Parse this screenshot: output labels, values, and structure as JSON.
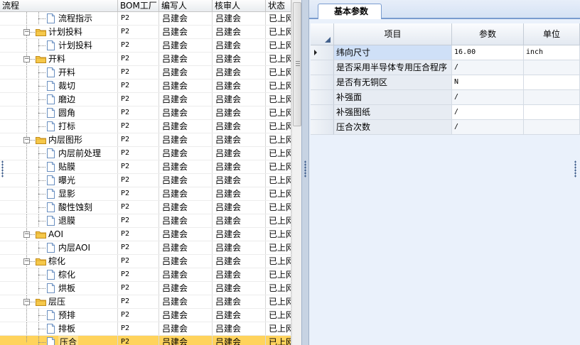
{
  "left_grid": {
    "columns": {
      "name": "流程",
      "bom": "BOM工厂",
      "writer": "编写人",
      "reviewer": "核审人",
      "status": "状态"
    },
    "rows": [
      {
        "type": "leaf",
        "name": "流程指示",
        "bom": "P2",
        "writer": "吕建会",
        "reviewer": "吕建会",
        "status": "已上网"
      },
      {
        "type": "folder",
        "name": "计划投料",
        "bom": "P2",
        "writer": "吕建会",
        "reviewer": "吕建会",
        "status": "已上网"
      },
      {
        "type": "leaf",
        "name": "计划投料",
        "bom": "P2",
        "writer": "吕建会",
        "reviewer": "吕建会",
        "status": "已上网"
      },
      {
        "type": "folder",
        "name": "开料",
        "bom": "P2",
        "writer": "吕建会",
        "reviewer": "吕建会",
        "status": "已上网"
      },
      {
        "type": "leaf",
        "name": "开料",
        "bom": "P2",
        "writer": "吕建会",
        "reviewer": "吕建会",
        "status": "已上网"
      },
      {
        "type": "leaf",
        "name": "裁切",
        "bom": "P2",
        "writer": "吕建会",
        "reviewer": "吕建会",
        "status": "已上网"
      },
      {
        "type": "leaf",
        "name": "磨边",
        "bom": "P2",
        "writer": "吕建会",
        "reviewer": "吕建会",
        "status": "已上网"
      },
      {
        "type": "leaf",
        "name": "圆角",
        "bom": "P2",
        "writer": "吕建会",
        "reviewer": "吕建会",
        "status": "已上网"
      },
      {
        "type": "leaf",
        "name": "打标",
        "bom": "P2",
        "writer": "吕建会",
        "reviewer": "吕建会",
        "status": "已上网"
      },
      {
        "type": "folder",
        "name": "内层图形",
        "bom": "P2",
        "writer": "吕建会",
        "reviewer": "吕建会",
        "status": "已上网"
      },
      {
        "type": "leaf",
        "name": "内层前处理",
        "bom": "P2",
        "writer": "吕建会",
        "reviewer": "吕建会",
        "status": "已上网"
      },
      {
        "type": "leaf",
        "name": "贴膜",
        "bom": "P2",
        "writer": "吕建会",
        "reviewer": "吕建会",
        "status": "已上网"
      },
      {
        "type": "leaf",
        "name": "曝光",
        "bom": "P2",
        "writer": "吕建会",
        "reviewer": "吕建会",
        "status": "已上网"
      },
      {
        "type": "leaf",
        "name": "显影",
        "bom": "P2",
        "writer": "吕建会",
        "reviewer": "吕建会",
        "status": "已上网"
      },
      {
        "type": "leaf",
        "name": "酸性蚀刻",
        "bom": "P2",
        "writer": "吕建会",
        "reviewer": "吕建会",
        "status": "已上网"
      },
      {
        "type": "leaf",
        "name": "退膜",
        "bom": "P2",
        "writer": "吕建会",
        "reviewer": "吕建会",
        "status": "已上网"
      },
      {
        "type": "folder",
        "name": "AOI",
        "bom": "P2",
        "writer": "吕建会",
        "reviewer": "吕建会",
        "status": "已上网"
      },
      {
        "type": "leaf",
        "name": "内层AOI",
        "bom": "P2",
        "writer": "吕建会",
        "reviewer": "吕建会",
        "status": "已上网"
      },
      {
        "type": "folder",
        "name": "棕化",
        "bom": "P2",
        "writer": "吕建会",
        "reviewer": "吕建会",
        "status": "已上网"
      },
      {
        "type": "leaf",
        "name": "棕化",
        "bom": "P2",
        "writer": "吕建会",
        "reviewer": "吕建会",
        "status": "已上网"
      },
      {
        "type": "leaf",
        "name": "烘板",
        "bom": "P2",
        "writer": "吕建会",
        "reviewer": "吕建会",
        "status": "已上网"
      },
      {
        "type": "folder",
        "name": "层压",
        "bom": "P2",
        "writer": "吕建会",
        "reviewer": "吕建会",
        "status": "已上网"
      },
      {
        "type": "leaf",
        "name": "预排",
        "bom": "P2",
        "writer": "吕建会",
        "reviewer": "吕建会",
        "status": "已上网"
      },
      {
        "type": "leaf",
        "name": "排板",
        "bom": "P2",
        "writer": "吕建会",
        "reviewer": "吕建会",
        "status": "已上网"
      },
      {
        "type": "leaf",
        "name": "压合",
        "bom": "P2",
        "writer": "吕建会",
        "reviewer": "吕建会",
        "status": "已上网",
        "selected": true
      }
    ]
  },
  "right_panel": {
    "tab_label": "基本参数",
    "columns": {
      "item": "项目",
      "value": "参数",
      "unit": "单位"
    },
    "rows": [
      {
        "item": "纬向尺寸",
        "value": "16.00",
        "unit": "inch",
        "current": true
      },
      {
        "item": "是否采用半导体专用压合程序",
        "value": "/",
        "unit": ""
      },
      {
        "item": "是否有无铜区",
        "value": "N",
        "unit": ""
      },
      {
        "item": "补强面",
        "value": "/",
        "unit": ""
      },
      {
        "item": "补强图纸",
        "value": "/",
        "unit": ""
      },
      {
        "item": "压合次数",
        "value": "/",
        "unit": ""
      }
    ]
  },
  "colors": {
    "selection": "#ffd35c",
    "tab_border": "#7a9ccf",
    "panel_bg": "#eaf1fb"
  }
}
